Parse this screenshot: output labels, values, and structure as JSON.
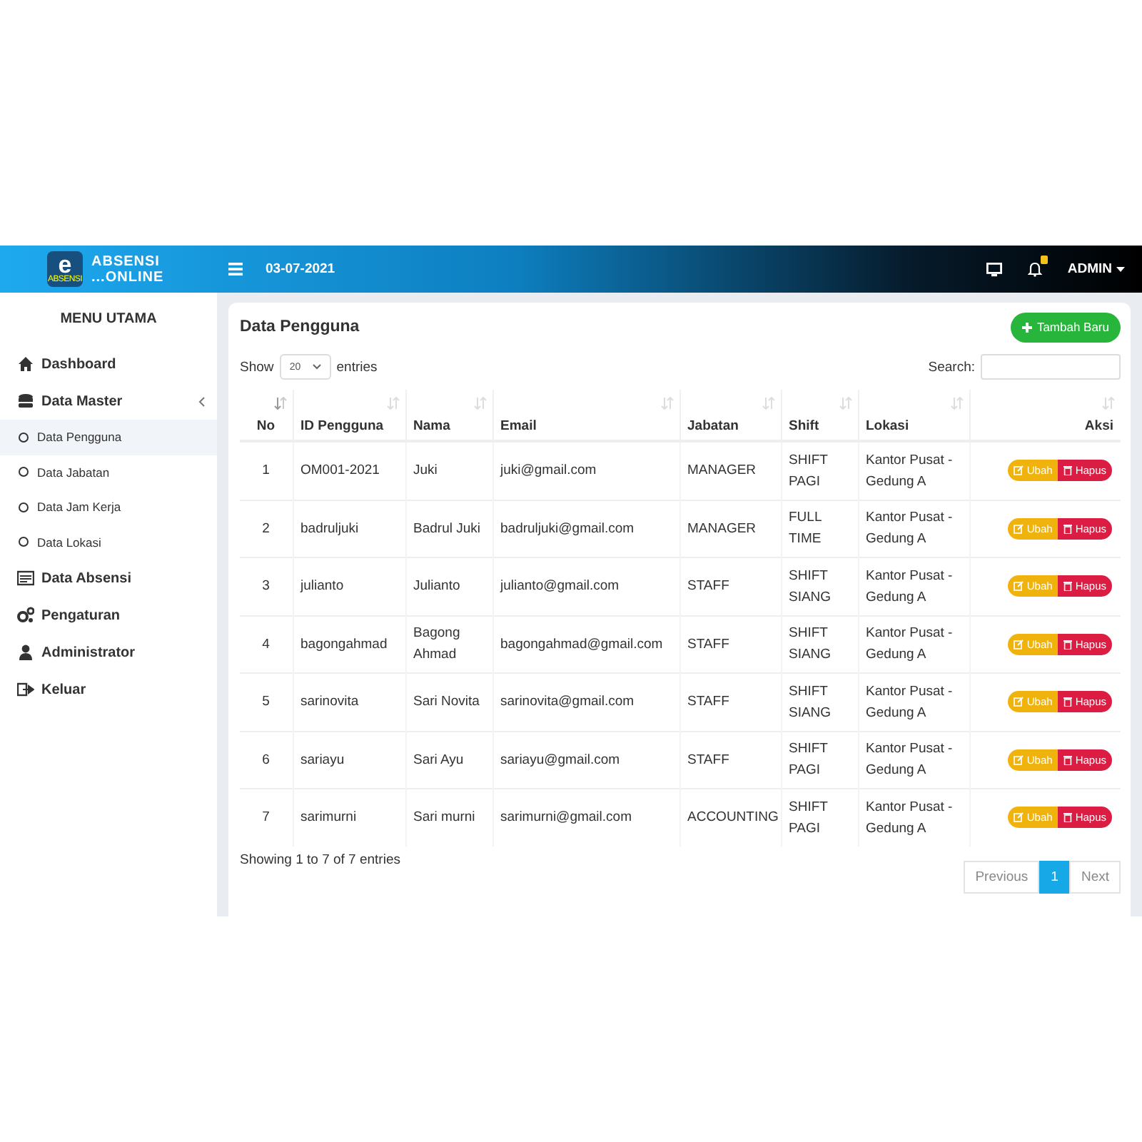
{
  "header": {
    "brand_top": "ABSENSI",
    "brand_bottom": "...ONLINE",
    "logo_letter": "e",
    "logo_caption": "ABSENSI",
    "date": "03-07-2021",
    "user": "ADMIN"
  },
  "sidebar": {
    "title": "MENU UTAMA",
    "items": [
      {
        "label": "Dashboard",
        "selected": false
      },
      {
        "label": "Data Master",
        "selected": false,
        "expanded": true,
        "children": [
          {
            "label": "Data Pengguna",
            "selected": true
          },
          {
            "label": "Data Jabatan",
            "selected": false
          },
          {
            "label": "Data Jam Kerja",
            "selected": false
          },
          {
            "label": "Data Lokasi",
            "selected": false
          }
        ]
      },
      {
        "label": "Data Absensi",
        "selected": false
      },
      {
        "label": "Pengaturan",
        "selected": false
      },
      {
        "label": "Administrator",
        "selected": false
      },
      {
        "label": "Keluar",
        "selected": false
      }
    ]
  },
  "card": {
    "title": "Data Pengguna",
    "add_button": "Tambah Baru",
    "show_label": "Show",
    "page_size": "20",
    "entries_label": "entries",
    "search_label": "Search:",
    "table": {
      "columns": [
        {
          "label": "No",
          "sorted": true
        },
        {
          "label": "ID Pengguna",
          "sorted": false
        },
        {
          "label": "Nama",
          "sorted": false
        },
        {
          "label": "Email",
          "sorted": false
        },
        {
          "label": "Jabatan",
          "sorted": false
        },
        {
          "label": "Shift",
          "sorted": false
        },
        {
          "label": "Lokasi",
          "sorted": false
        },
        {
          "label": "Aksi",
          "sorted": false
        }
      ],
      "rows": [
        {
          "cells": [
            "1",
            "OM001-2021",
            "Juki",
            "juki@gmail.com",
            "MANAGER",
            "SHIFT PAGI",
            "Kantor Pusat - Gedung A"
          ],
          "actions": [
            "Ubah",
            "Hapus"
          ]
        },
        {
          "cells": [
            "2",
            "badruljuki",
            "Badrul Juki",
            "badruljuki@gmail.com",
            "MANAGER",
            "FULL TIME",
            "Kantor Pusat - Gedung A"
          ],
          "actions": [
            "Ubah",
            "Hapus"
          ]
        },
        {
          "cells": [
            "3",
            "julianto",
            "Julianto",
            "julianto@gmail.com",
            "STAFF",
            "SHIFT SIANG",
            "Kantor Pusat - Gedung A"
          ],
          "actions": [
            "Ubah",
            "Hapus"
          ]
        },
        {
          "cells": [
            "4",
            "bagongahmad",
            "Bagong Ahmad",
            "bagongahmad@gmail.com",
            "STAFF",
            "SHIFT SIANG",
            "Kantor Pusat - Gedung A"
          ],
          "actions": [
            "Ubah",
            "Hapus"
          ]
        },
        {
          "cells": [
            "5",
            "sarinovita",
            "Sari Novita",
            "sarinovita@gmail.com",
            "STAFF",
            "SHIFT SIANG",
            "Kantor Pusat - Gedung A"
          ],
          "actions": [
            "Ubah",
            "Hapus"
          ]
        },
        {
          "cells": [
            "6",
            "sariayu",
            "Sari Ayu",
            "sariayu@gmail.com",
            "STAFF",
            "SHIFT PAGI",
            "Kantor Pusat - Gedung A"
          ],
          "actions": [
            "Ubah",
            "Hapus"
          ]
        },
        {
          "cells": [
            "7",
            "sarimurni",
            "Sari murni",
            "sarimurni@gmail.com",
            "ACCOUNTING",
            "SHIFT PAGI",
            "Kantor Pusat - Gedung A"
          ],
          "actions": [
            "Ubah",
            "Hapus"
          ]
        }
      ]
    },
    "info": "Showing 1 to 7 of 7 entries",
    "pagination": [
      {
        "label": "Previous",
        "selected": false
      },
      {
        "label": "1",
        "selected": true
      },
      {
        "label": "Next",
        "selected": false
      }
    ]
  }
}
